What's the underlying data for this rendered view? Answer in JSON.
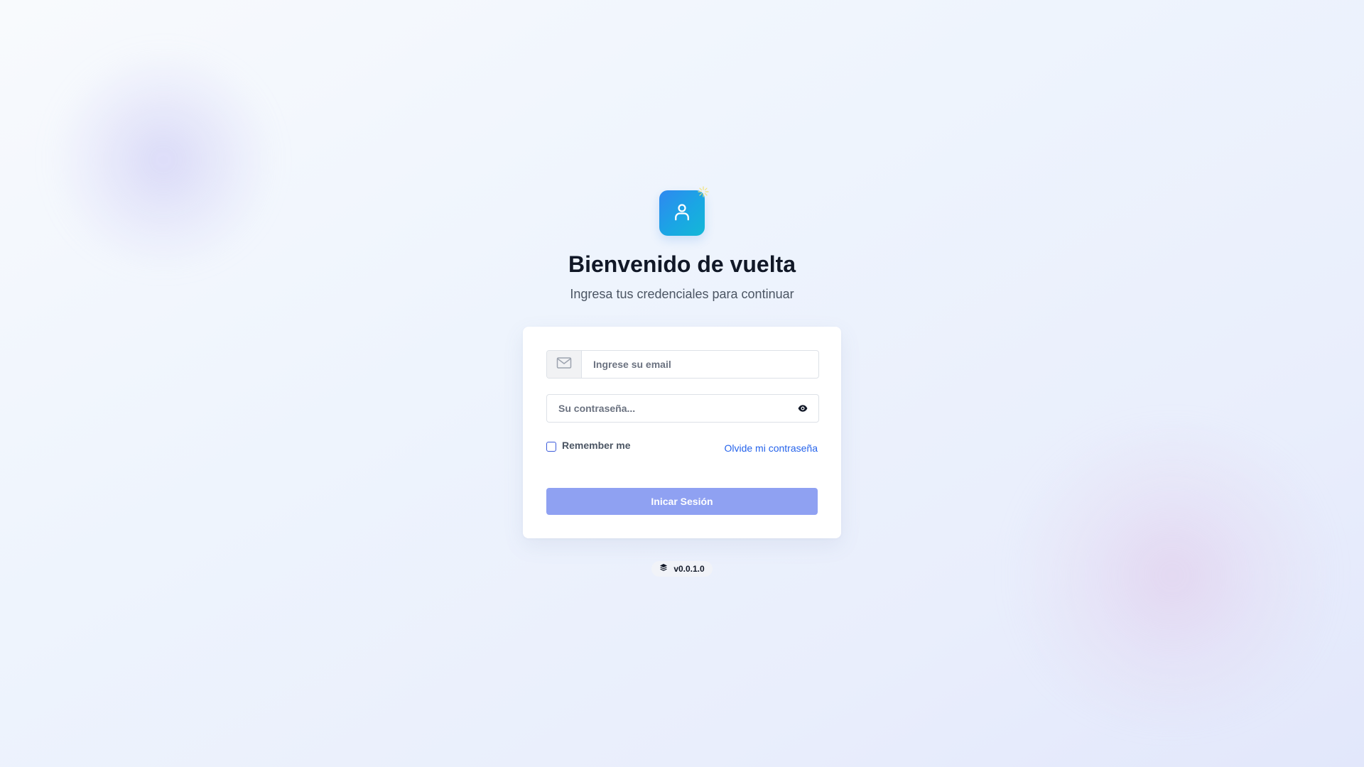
{
  "header": {
    "logo_icon": "user-icon",
    "sparkle_icon": "sparkle-icon",
    "title": "Bienvenido de vuelta",
    "subtitle": "Ingresa tus credenciales para continuar"
  },
  "form": {
    "email": {
      "icon": "mail-icon",
      "placeholder": "Ingrese su email",
      "value": ""
    },
    "password": {
      "placeholder": "Su contraseña...",
      "value": "",
      "toggle_icon": "eye-icon"
    },
    "remember_label": "Remember me",
    "remember_checked": false,
    "forgot_label": "Olvide mi contraseña",
    "submit_label": "Inicar Sesión"
  },
  "footer": {
    "version_icon": "layers-icon",
    "version": "v0.0.1.0"
  },
  "colors": {
    "brand_gradient_start": "#2f88f0",
    "brand_gradient_end": "#14b8d6",
    "button": "#8fa1f2",
    "link": "#2563eb",
    "checkbox_border": "#3b5bdb"
  }
}
